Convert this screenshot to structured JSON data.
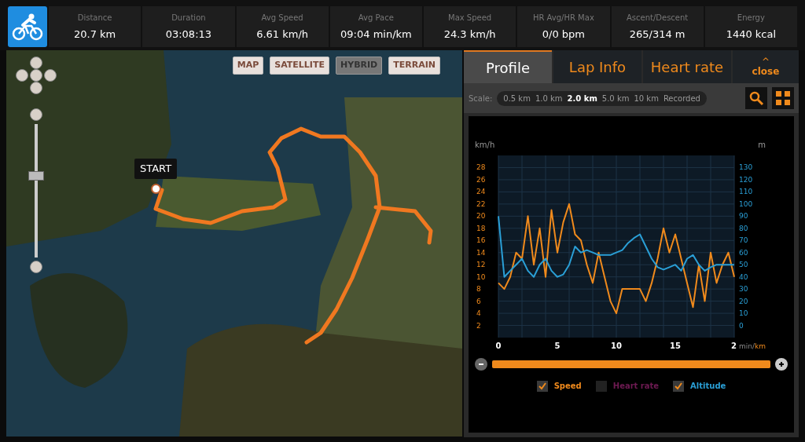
{
  "stats": [
    {
      "label": "Distance",
      "value": "20.7 km"
    },
    {
      "label": "Duration",
      "value": "03:08:13"
    },
    {
      "label": "Avg Speed",
      "value": "6.61 km/h"
    },
    {
      "label": "Avg Pace",
      "value": "09:04 min/km"
    },
    {
      "label": "Max Speed",
      "value": "24.3 km/h"
    },
    {
      "label": "HR Avg/HR Max",
      "value": "0/0 bpm"
    },
    {
      "label": "Ascent/Descent",
      "value": "265/314 m"
    },
    {
      "label": "Energy",
      "value": "1440 kcal"
    }
  ],
  "map": {
    "map_types": [
      {
        "label": "MAP",
        "selected": false
      },
      {
        "label": "SATELLITE",
        "selected": false
      },
      {
        "label": "HYBRID",
        "selected": true
      },
      {
        "label": "TERRAIN",
        "selected": false
      }
    ],
    "zoom": {
      "level": 0.62
    },
    "start_label": "START"
  },
  "tabs": [
    {
      "label": "Profile",
      "selected": true
    },
    {
      "label": "Lap Info",
      "selected": false
    },
    {
      "label": "Heart rate",
      "selected": false
    }
  ],
  "close": {
    "icon": "^",
    "label": "close"
  },
  "scale": {
    "label": "Scale:",
    "options": [
      {
        "label": "0.5 km",
        "selected": false
      },
      {
        "label": "1.0 km",
        "selected": false
      },
      {
        "label": "2.0 km",
        "selected": true
      },
      {
        "label": "5.0 km",
        "selected": false
      },
      {
        "label": "10 km",
        "selected": false
      },
      {
        "label": "Recorded",
        "selected": false
      }
    ]
  },
  "profile": {
    "right_unit": "m",
    "x_end_label": "2",
    "altitude_ticks": [
      "130",
      "120",
      "110",
      "100",
      "90",
      "80",
      "70",
      "60",
      "50",
      "40",
      "30",
      "20",
      "10",
      "0"
    ],
    "x_unit_a": "min/",
    "x_unit_b": "km",
    "chart_data": {
      "type": "line",
      "ylabel": "km/h",
      "xlim": [
        0,
        20
      ],
      "ylim": [
        0,
        30
      ],
      "x": [
        0,
        0.5,
        1,
        1.5,
        2,
        2.5,
        3,
        3.5,
        4,
        4.5,
        5,
        5.5,
        6,
        6.5,
        7,
        7.5,
        8,
        8.5,
        9,
        9.5,
        10,
        10.5,
        11,
        11.5,
        12,
        12.5,
        13,
        13.5,
        14,
        14.5,
        15,
        15.5,
        16,
        16.5,
        17,
        17.5,
        18,
        18.5,
        19,
        19.5,
        20
      ],
      "grid": true,
      "series": [
        {
          "name": "Speed",
          "color": "#f08a1c",
          "values": [
            9,
            8,
            10,
            14,
            13,
            20,
            12,
            18,
            10,
            21,
            14,
            19,
            22,
            17,
            16,
            12,
            9,
            14,
            10,
            6,
            4,
            8,
            8,
            8,
            8,
            6,
            9,
            13,
            18,
            14,
            17,
            13,
            9,
            5,
            12,
            6,
            14,
            9,
            12,
            14,
            10
          ]
        },
        {
          "name": "Altitude",
          "color": "#2a9fd6",
          "values": [
            20,
            10,
            11,
            12,
            13,
            11,
            10,
            12,
            13,
            11,
            10,
            10.4,
            12,
            15,
            14,
            14.4,
            14,
            13.6,
            13.6,
            13.6,
            14,
            14.4,
            15.6,
            16.4,
            17,
            15,
            13,
            11.6,
            11.2,
            11.6,
            12,
            11,
            13,
            13.6,
            12,
            11,
            11.6,
            12,
            12,
            12,
            12
          ]
        }
      ],
      "xticks": [
        0,
        5,
        10,
        15
      ],
      "yticks": [
        28,
        26,
        24,
        22,
        20,
        18,
        16,
        14,
        12,
        10,
        8,
        6,
        4,
        2
      ]
    },
    "range": {
      "level": 1
    }
  },
  "legend": [
    {
      "kind": "series",
      "checked": true
    },
    {
      "kind": "plain",
      "label": "Heart rate",
      "checked": false,
      "color": "#6e1a52"
    },
    {
      "kind": "series",
      "checked": true
    }
  ]
}
